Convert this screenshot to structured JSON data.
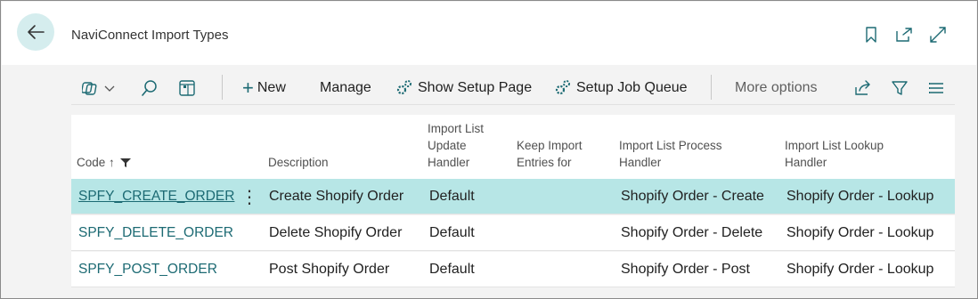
{
  "header": {
    "title": "NaviConnect Import Types"
  },
  "toolbar": {
    "new_label": "New",
    "manage_label": "Manage",
    "show_setup_label": "Show Setup Page",
    "setup_job_label": "Setup Job Queue",
    "more_options_label": "More options"
  },
  "columns": {
    "code": "Code ↑",
    "description": "Description",
    "update_handler": "Import List\nUpdate\nHandler",
    "keep_entries": "Keep Import\nEntries for",
    "process_handler": "Import List Process\nHandler",
    "lookup_handler": "Import List Lookup\nHandler"
  },
  "rows": [
    {
      "code": "SPFY_CREATE_ORDER",
      "description": "Create Shopify Order",
      "update_handler": "Default",
      "keep_entries": "",
      "process_handler": "Shopify Order - Create",
      "lookup_handler": "Shopify Order - Lookup"
    },
    {
      "code": "SPFY_DELETE_ORDER",
      "description": "Delete Shopify Order",
      "update_handler": "Default",
      "keep_entries": "",
      "process_handler": "Shopify Order - Delete",
      "lookup_handler": "Shopify Order - Lookup"
    },
    {
      "code": "SPFY_POST_ORDER",
      "description": "Post Shopify Order",
      "update_handler": "Default",
      "keep_entries": "",
      "process_handler": "Shopify Order - Post",
      "lookup_handler": "Shopify Order - Lookup"
    }
  ],
  "colors": {
    "accent": "#1c6a73",
    "selected_row": "#b7e6e6",
    "back_button": "#d5edee"
  }
}
